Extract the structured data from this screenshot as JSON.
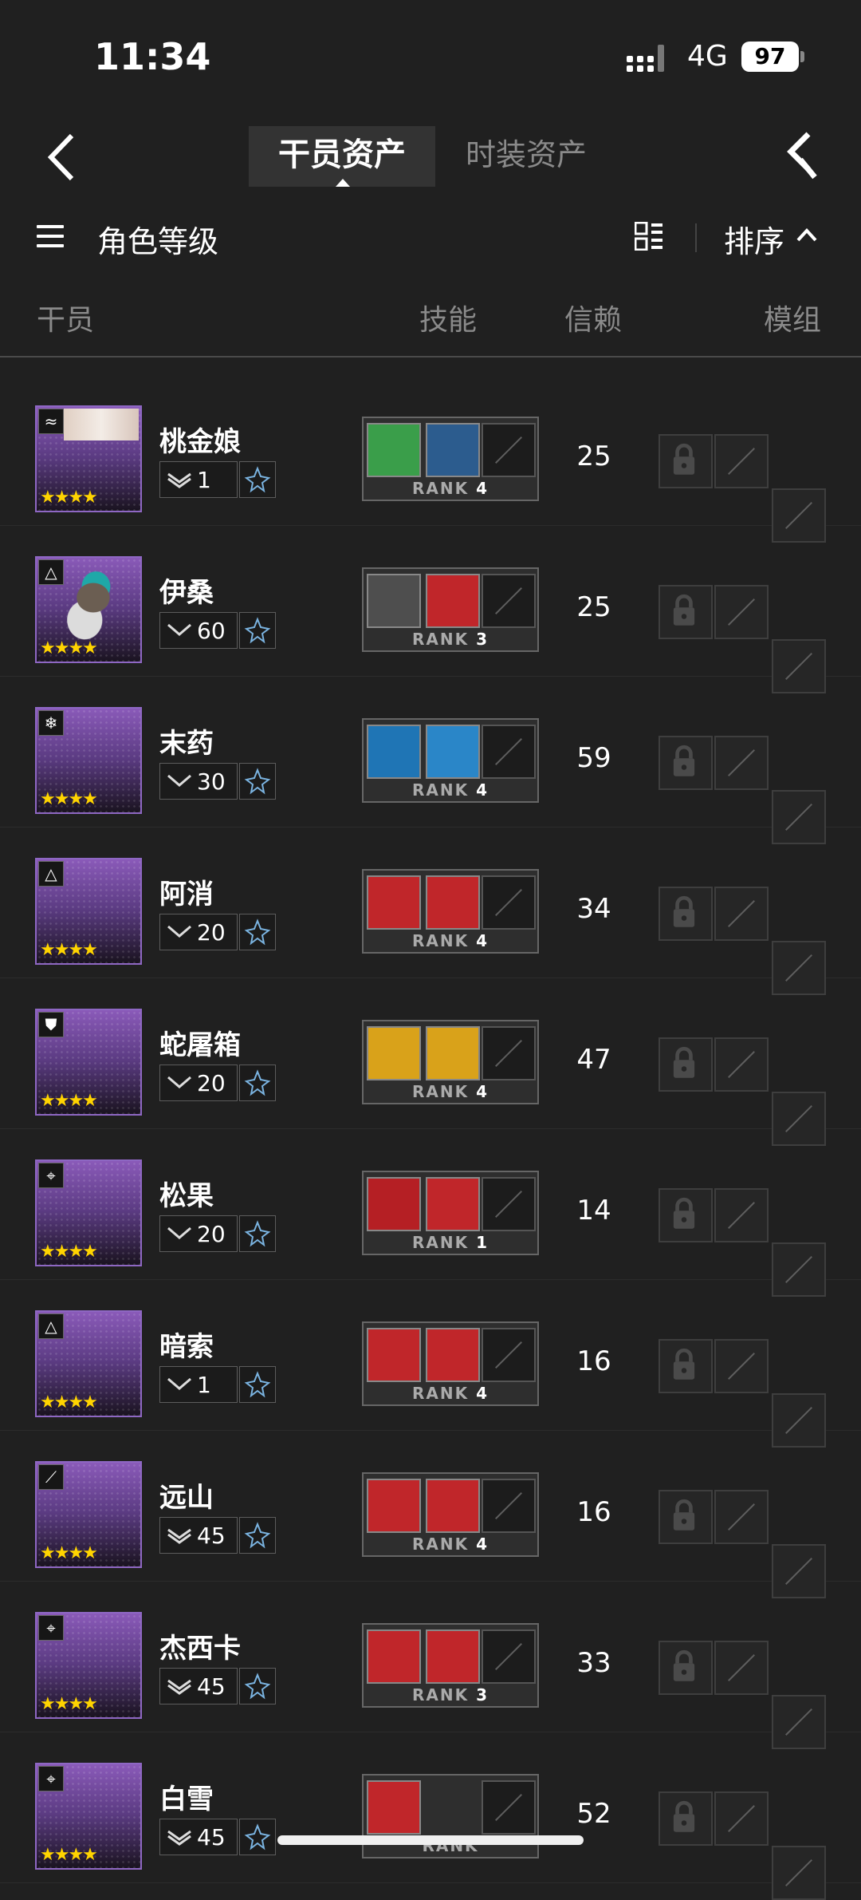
{
  "status_bar": {
    "time": "11:34",
    "network": "4G",
    "battery": "97"
  },
  "nav": {
    "tab_active": "干员资产",
    "tab_inactive": "时装资产"
  },
  "toolbar": {
    "sort_field": "角色等级",
    "sort_label": "排序"
  },
  "headers": {
    "operator": "干员",
    "skills": "技能",
    "trust": "信赖",
    "module": "模组"
  },
  "skill_rank_prefix": "RANK",
  "operators": [
    {
      "name": "桃金娘",
      "class_icon": "vanguard-icon",
      "stars": "★★★★",
      "elite": 2,
      "level": "1",
      "skill_rank": "4",
      "trust": "25"
    },
    {
      "name": "伊桑",
      "class_icon": "specialist-icon",
      "stars": "★★★★",
      "elite": 1,
      "level": "60",
      "skill_rank": "3",
      "trust": "25"
    },
    {
      "name": "末药",
      "class_icon": "medic-icon",
      "stars": "★★★★",
      "elite": 1,
      "level": "30",
      "skill_rank": "4",
      "trust": "59"
    },
    {
      "name": "阿消",
      "class_icon": "specialist-icon",
      "stars": "★★★★",
      "elite": 1,
      "level": "20",
      "skill_rank": "4",
      "trust": "34"
    },
    {
      "name": "蛇屠箱",
      "class_icon": "defender-icon",
      "stars": "★★★★",
      "elite": 1,
      "level": "20",
      "skill_rank": "4",
      "trust": "47"
    },
    {
      "name": "松果",
      "class_icon": "sniper-icon",
      "stars": "★★★★",
      "elite": 1,
      "level": "20",
      "skill_rank": "1",
      "trust": "14"
    },
    {
      "name": "暗索",
      "class_icon": "specialist-icon",
      "stars": "★★★★",
      "elite": 1,
      "level": "1",
      "skill_rank": "4",
      "trust": "16"
    },
    {
      "name": "远山",
      "class_icon": "caster-icon",
      "stars": "★★★★",
      "elite": 2,
      "level": "45",
      "skill_rank": "4",
      "trust": "16"
    },
    {
      "name": "杰西卡",
      "class_icon": "sniper-icon",
      "stars": "★★★★",
      "elite": 2,
      "level": "45",
      "skill_rank": "3",
      "trust": "33"
    },
    {
      "name": "白雪",
      "class_icon": "sniper-icon",
      "stars": "★★★★",
      "elite": 2,
      "level": "45",
      "skill_rank": "",
      "trust": "52"
    }
  ],
  "skill_icon_colors": [
    [
      "#3a9e4a",
      "#2c5c8e"
    ],
    [
      "#4e4e4e",
      "#c0262a"
    ],
    [
      "#1f75b5",
      "#2a86c8"
    ],
    [
      "#c0262a",
      "#c0262a"
    ],
    [
      "#d9a21a",
      "#d9a21a"
    ],
    [
      "#b51f24",
      "#c0262a"
    ],
    [
      "#c0262a",
      "#c0262a"
    ],
    [
      "#c0262a",
      "#c0262a"
    ],
    [
      "#c0262a",
      "#c0262a"
    ],
    [
      "#c0262a",
      "#2e2e2e"
    ]
  ]
}
